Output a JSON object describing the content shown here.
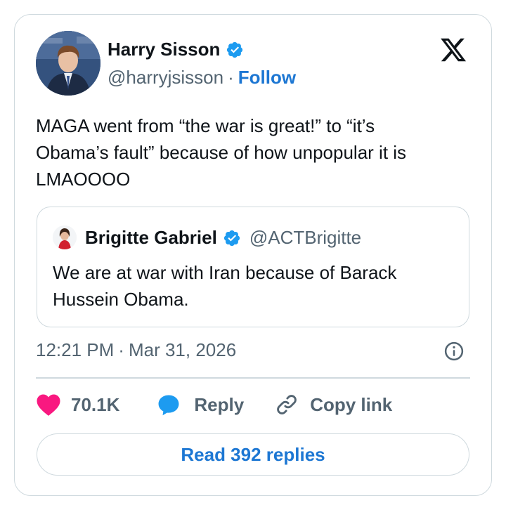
{
  "author": {
    "name": "Harry Sisson",
    "handle": "@harryjsisson",
    "separator": "·",
    "follow_label": "Follow"
  },
  "tweet": {
    "text": "MAGA went from “the war is great!” to “it’s\nObama’s fault” because of how unpopular it is\nLMAOOOO",
    "time": "12:21 PM",
    "separator": "·",
    "date": "Mar 31, 2026"
  },
  "quoted": {
    "name": "Brigitte Gabriel",
    "handle": "@ACTBrigitte",
    "text": "We are at war with Iran because of Barack\nHussein Obama."
  },
  "actions": {
    "likes": "70.1K",
    "reply_label": "Reply",
    "copy_label": "Copy link"
  },
  "footer": {
    "read_replies_label": "Read 392 replies"
  },
  "icons": {
    "verified": "verified-badge-icon",
    "x_logo": "x-logo-icon",
    "info": "info-icon",
    "like": "heart-icon",
    "reply": "speech-bubble-icon",
    "copy": "link-icon"
  },
  "colors": {
    "accent": "#1d77d3",
    "verified": "#1d9bf0",
    "like": "#f91880",
    "text": "#0f1419",
    "muted": "#536471",
    "border": "#cfd9de"
  }
}
